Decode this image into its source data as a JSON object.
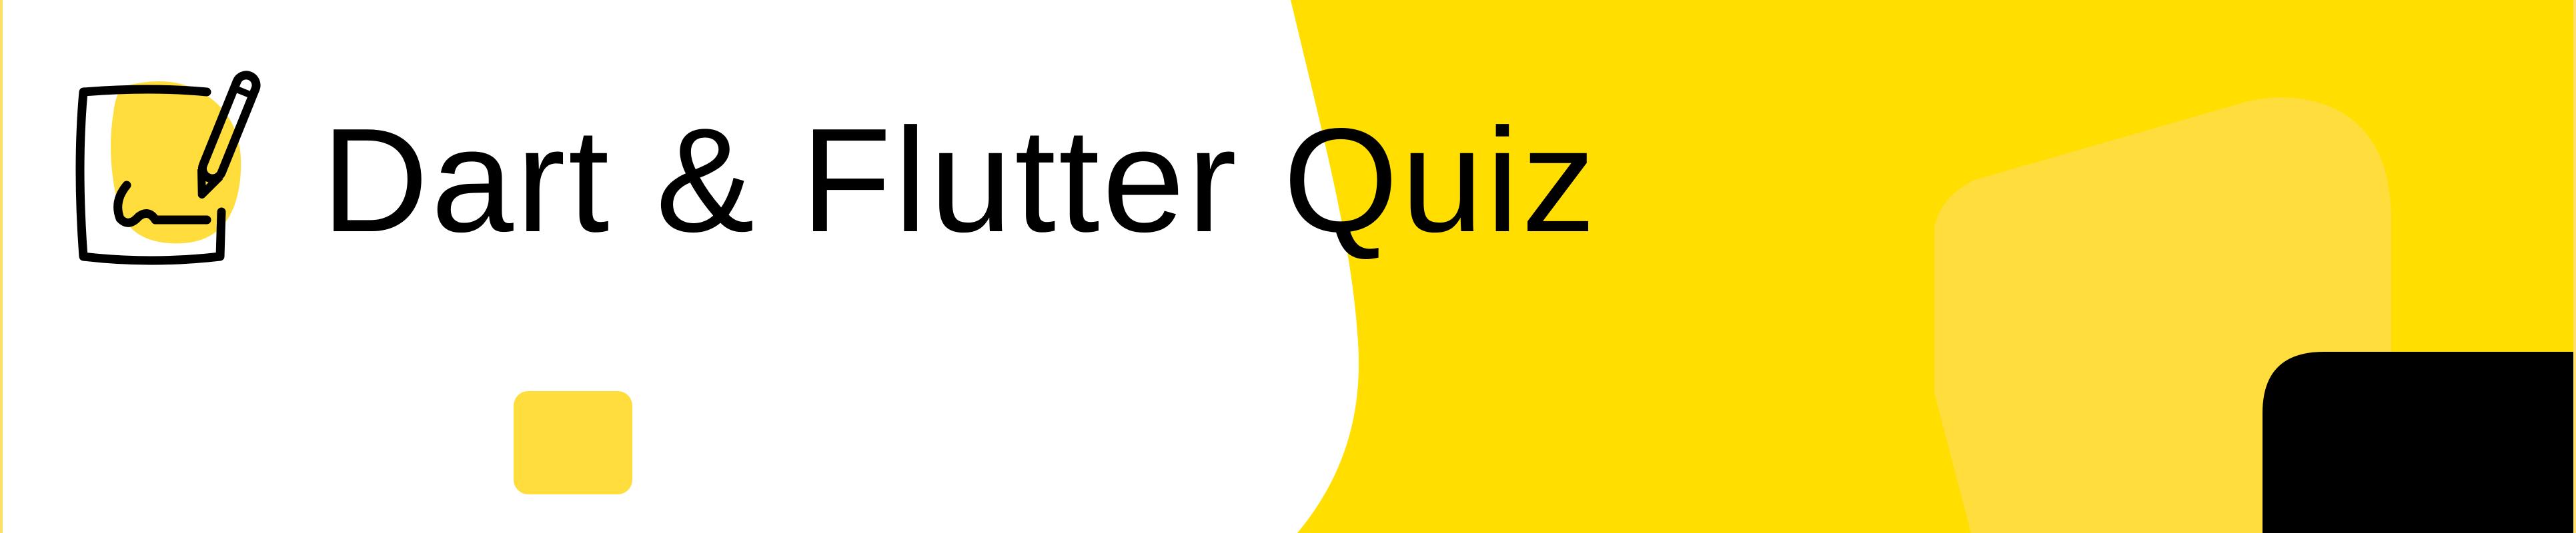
{
  "banner": {
    "title": "Dart & Flutter Quiz",
    "logo_icon": "edit-note-icon"
  },
  "colors": {
    "background": "#ffffff",
    "accent_yellow": "#FFDE00",
    "light_yellow": "#FFDD3D",
    "black": "#000000"
  }
}
